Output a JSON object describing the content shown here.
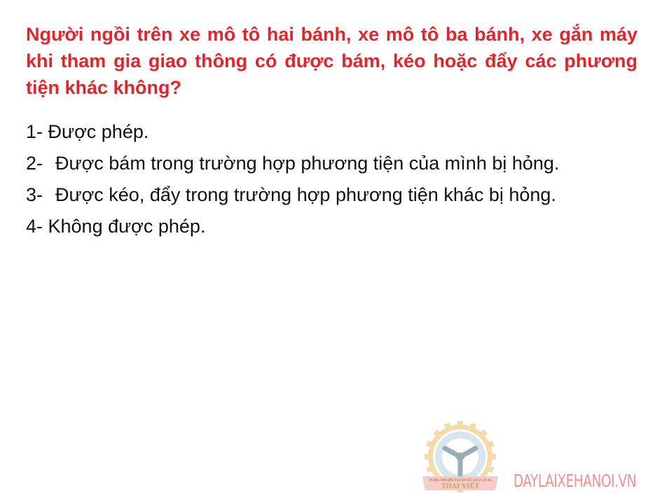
{
  "question": "Người ngồi trên xe mô tô hai bánh, xe mô tô ba bánh, xe gắn máy khi tham gia giao thông có được bám, kéo hoặc đẩy các phương tiện khác không?",
  "answers": [
    {
      "num": "1- ",
      "text": "Được phép."
    },
    {
      "num": "2-",
      "text": "Được bám trong trường hợp phương tiện của mình bị hỏng."
    },
    {
      "num": "3-",
      "text": "Được kéo, đẩy trong trường hợp phương tiện khác bị hỏng."
    },
    {
      "num": "4- ",
      "text": "Không được phép."
    }
  ],
  "logo": {
    "icon": "steering-wheel-gear-logo",
    "top_text": "TRUNG TÂM ĐÀO TẠO VÀ SÁT HẠCH LÁI XE",
    "bottom_text": "THÁI VIỆT",
    "colors": {
      "gear": "#f2d9a0",
      "wheel": "#cfe0e6",
      "spokes": "#8fa9b0",
      "banner": "#e9a4a0"
    }
  },
  "watermark": "DAYLAIXEHANOI.VN",
  "colors": {
    "question": "#e0262b",
    "answer": "#111111",
    "watermark": "#f07c7c"
  }
}
